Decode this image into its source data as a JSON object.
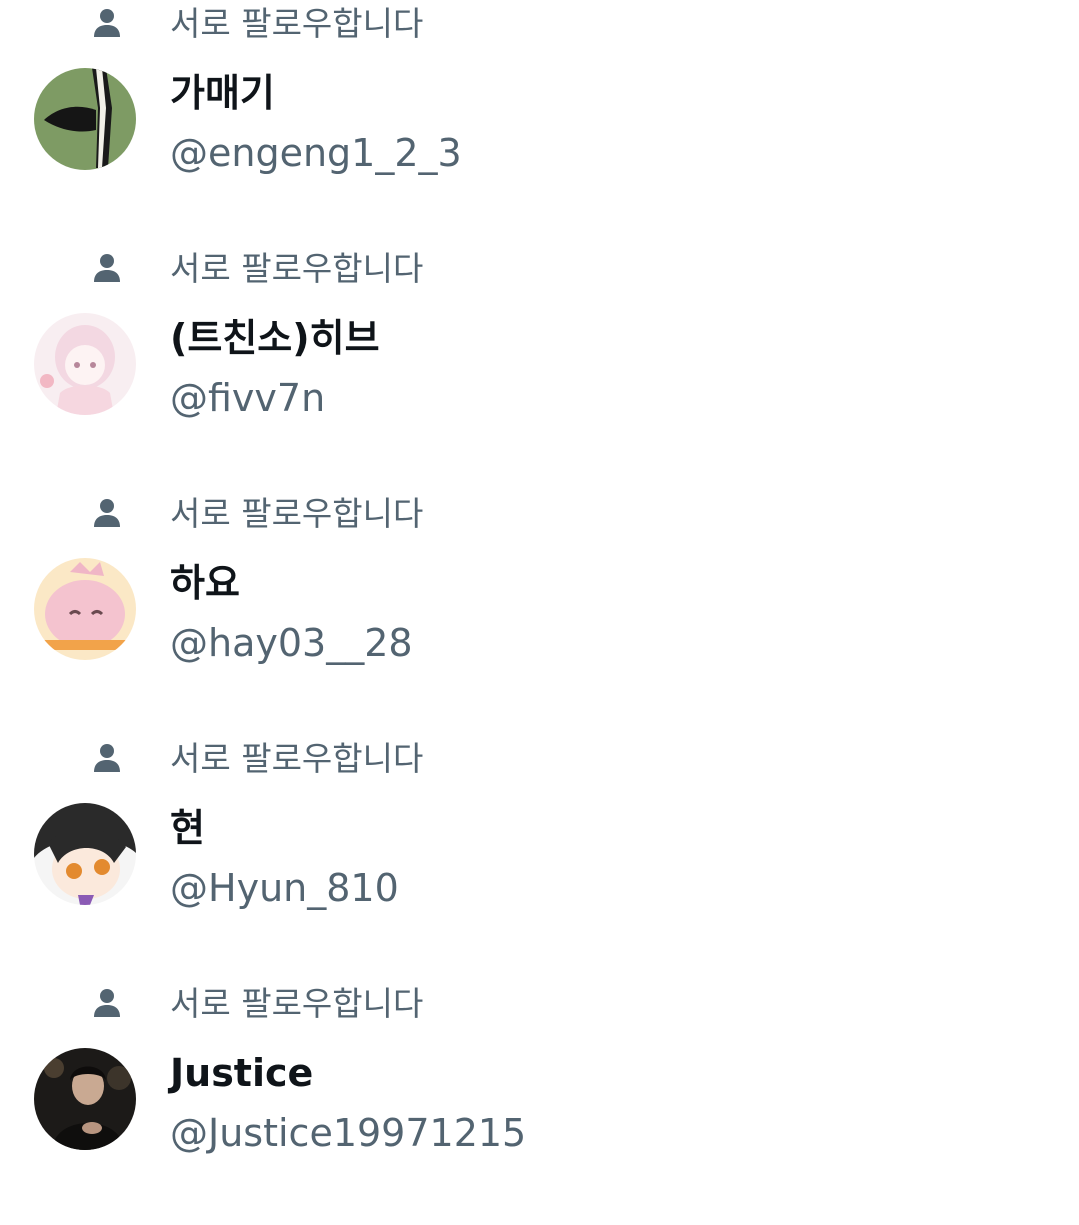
{
  "follow_list": {
    "items": [
      {
        "context_label": "서로 팔로우합니다",
        "context_icon": "person-icon",
        "display_name": "가매기",
        "handle": "@engeng1_2_3",
        "avatar_color": "#7e9b64"
      },
      {
        "context_label": "서로 팔로우합니다",
        "context_icon": "person-icon",
        "display_name": "(트친소)히브",
        "handle": "@fivv7n",
        "avatar_color": "#f6e2ea"
      },
      {
        "context_label": "서로 팔로우합니다",
        "context_icon": "person-icon",
        "display_name": "하요",
        "handle": "@hay03__28",
        "avatar_color": "#f4c3cf"
      },
      {
        "context_label": "서로 팔로우합니다",
        "context_icon": "person-icon",
        "display_name": "현",
        "handle": "@Hyun_810",
        "avatar_color": "#2a2a2a"
      },
      {
        "context_label": "서로 팔로우합니다",
        "context_icon": "person-icon",
        "display_name": "Justice",
        "handle": "@Justice19971215",
        "avatar_color": "#1c1a18"
      }
    ]
  },
  "colors": {
    "text_primary": "#0f1419",
    "text_secondary": "#536471",
    "background": "#ffffff"
  }
}
